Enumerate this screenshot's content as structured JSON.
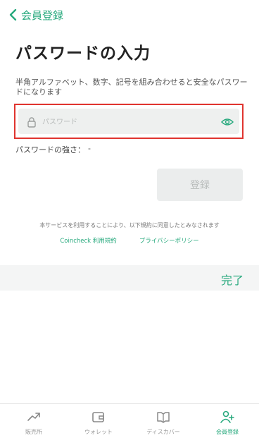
{
  "header": {
    "back_label": "会員登録"
  },
  "page": {
    "title": "パスワードの入力",
    "description": "半角アルファベット、数字、記号を組み合わせると安全なパスワードになります"
  },
  "form": {
    "password_placeholder": "パスワード",
    "strength_label": "パスワードの強さ：",
    "strength_value": "-",
    "submit_label": "登録"
  },
  "terms": {
    "notice": "本サービスを利用することにより、以下規約に同意したとみなされます",
    "link_terms": "Coincheck 利用規約",
    "link_privacy": "プライバシーポリシー"
  },
  "keyboard_bar": {
    "done_label": "完了"
  },
  "tabs": [
    {
      "label": "販売所",
      "icon": "trend-up-icon"
    },
    {
      "label": "ウォレット",
      "icon": "wallet-icon"
    },
    {
      "label": "ディスカバー",
      "icon": "book-icon"
    },
    {
      "label": "会員登録",
      "icon": "add-user-icon",
      "active": true
    }
  ],
  "colors": {
    "accent": "#27a97d",
    "highlight_border": "#e0342f",
    "field_bg": "#eef0ef"
  }
}
